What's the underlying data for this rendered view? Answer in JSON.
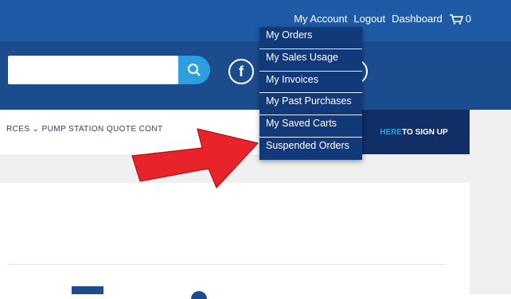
{
  "topnav": {
    "my_account": "My Account",
    "logout": "Logout",
    "dashboard": "Dashboard",
    "cart_count": "0"
  },
  "menu": {
    "items": [
      "My Orders",
      "My Sales Usage",
      "My Invoices",
      "My Past Purchases",
      "My Saved Carts",
      "Suspended Orders"
    ]
  },
  "nav": {
    "text": "RCES ⌄   PUMP STATION QUOTE   CONT"
  },
  "signup": {
    "highlight": "HERE",
    "text": " TO SIGN UP"
  },
  "colors": {
    "top": "#1e5aa6",
    "header": "#1b4d8e",
    "dropdown": "#123a7a",
    "signup": "#0f2f66",
    "accent": "#2c9fe0",
    "arrow": "#e8232a"
  }
}
